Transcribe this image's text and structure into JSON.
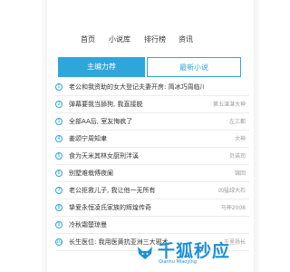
{
  "nav": {
    "items": [
      "首页",
      "小说库",
      "排行榜",
      "资讯"
    ]
  },
  "tabs": {
    "active_label": "主编力荐",
    "inactive_label": "最新小说"
  },
  "books": [
    {
      "num": "1",
      "title": "老公和我资助的女大登记夫妻开房: 简冰巧周临川",
      "author": ""
    },
    {
      "num": "2",
      "title": "弹幕要我当舔狗, 我直接脱",
      "author": "第五湛湛大神"
    },
    {
      "num": "3",
      "title": "全部AA后, 室友悔疯了",
      "author": "左三都"
    },
    {
      "num": "4",
      "title": "姜颂宁周知聿",
      "author": "大神"
    },
    {
      "num": "5",
      "title": "食为天米其林女厨刑泮溪",
      "author": "贝诺司"
    },
    {
      "num": "6",
      "title": "别墅难栽傅夜阑",
      "author": "锦回"
    },
    {
      "num": "7",
      "title": "老公拒救儿子, 我让他一无所有",
      "author": "凶猛绿大石"
    },
    {
      "num": "8",
      "title": "挚爱永恒凌氏家族的辉煌传奇",
      "author": "马神2008"
    },
    {
      "num": "9",
      "title": "冷秋霜楚琼曼",
      "author": ""
    },
    {
      "num": "10",
      "title": "长生医位: 我用医黄抗亚洲三大邪术",
      "author": "千里扬长"
    }
  ],
  "watermark": {
    "text": "千狐秒应",
    "sub": "Qianhu Miaoying"
  },
  "colors": {
    "accent": "#2ea6dc",
    "watermark": "#1f8fd8"
  }
}
